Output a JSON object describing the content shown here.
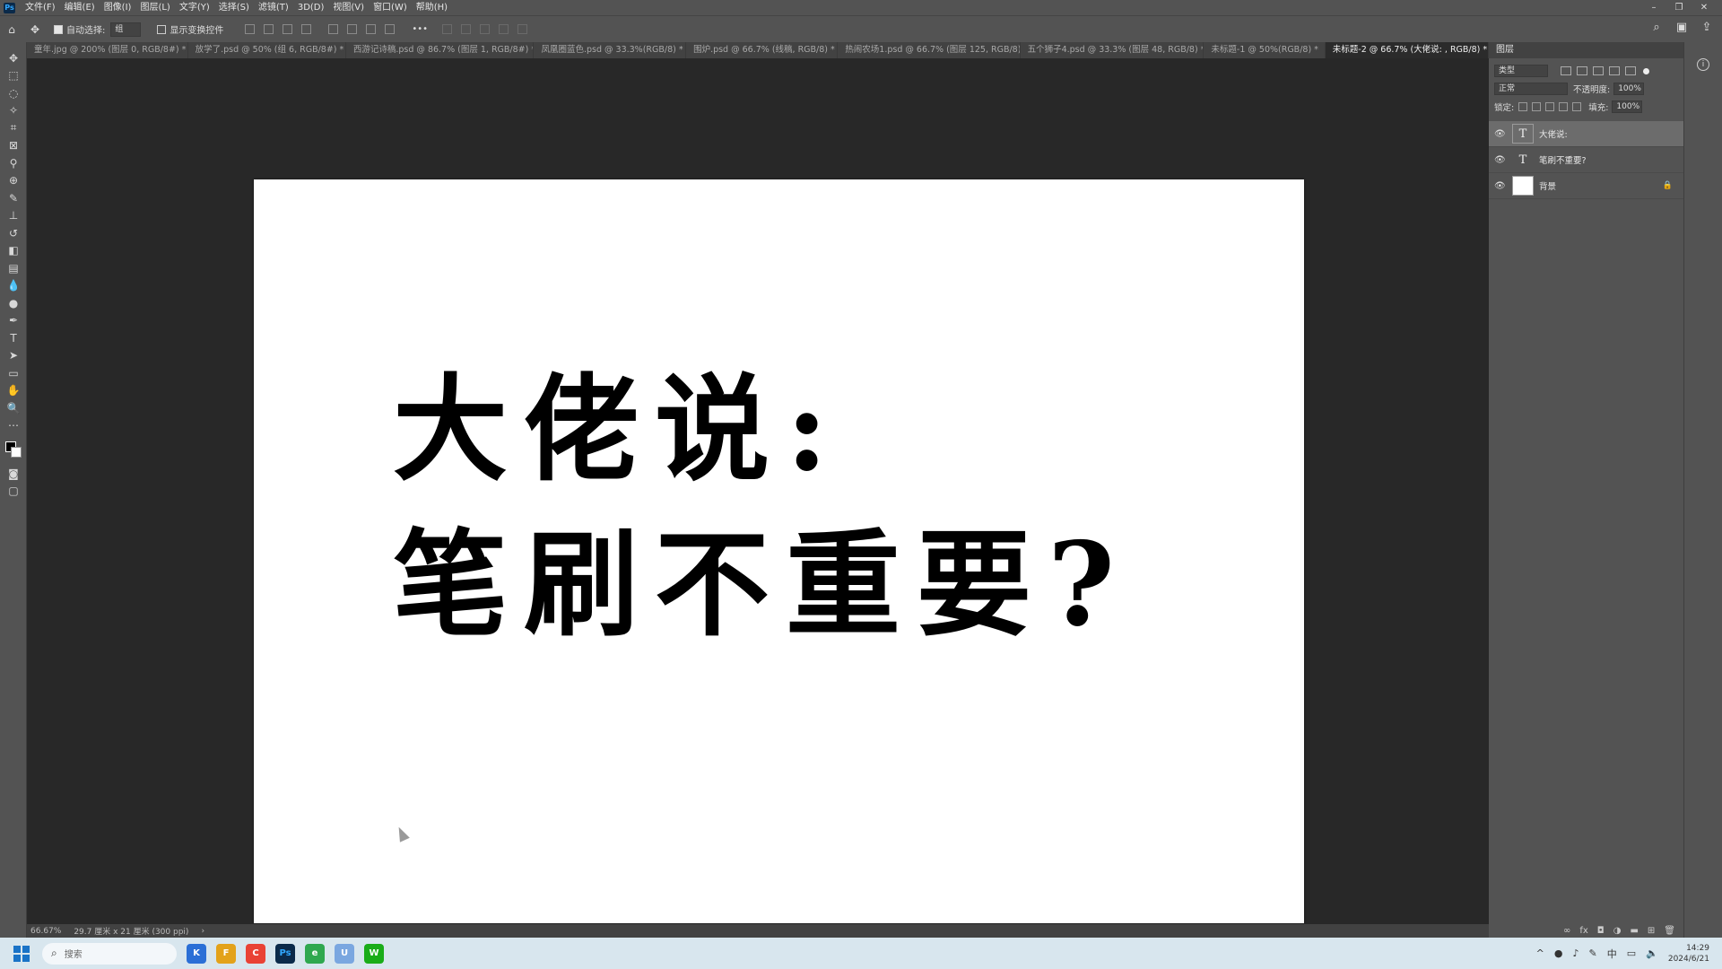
{
  "app": {
    "logo": "Ps"
  },
  "menu": [
    "文件(F)",
    "编辑(E)",
    "图像(I)",
    "图层(L)",
    "文字(Y)",
    "选择(S)",
    "滤镜(T)",
    "3D(D)",
    "视图(V)",
    "窗口(W)",
    "帮助(H)"
  ],
  "options_bar": {
    "auto_select_label": "自动选择:",
    "auto_select_value": "组",
    "show_transform_label": "显示变换控件",
    "more": "•••"
  },
  "tabs": [
    {
      "label": "童年.jpg @ 200% (图层 0, RGB/8#) *"
    },
    {
      "label": "放学了.psd @ 50% (组 6, RGB/8#) *"
    },
    {
      "label": "西游记诗稿.psd @ 86.7% (图层 1, RGB/8#) *"
    },
    {
      "label": "凤凰圈蓝色.psd @ 33.3%(RGB/8) *"
    },
    {
      "label": "围炉.psd @ 66.7% (线稿, RGB/8) *"
    },
    {
      "label": "热闹农场1.psd @ 66.7% (图层 125, RGB/8)"
    },
    {
      "label": "五个狮子4.psd @ 33.3% (图层 48, RGB/8) *"
    },
    {
      "label": "未标题-1 @ 50%(RGB/8) *"
    },
    {
      "label": "未标题-2 @ 66.7% (大佬说: , RGB/8) *"
    }
  ],
  "canvas": {
    "line1": "大佬说:",
    "line2": "笔刷不重要?"
  },
  "status": {
    "zoom": "66.67%",
    "doc_size": "29.7 厘米 x 21 厘米 (300 ppi)"
  },
  "layers_panel": {
    "title": "图层",
    "filter_kind": "类型",
    "blend_mode": "正常",
    "opacity_label": "不透明度:",
    "opacity_value": "100%",
    "lock_label": "锁定:",
    "fill_label": "填充:",
    "fill_value": "100%",
    "layers": [
      {
        "name": "大佬说:",
        "type": "text",
        "selected": true
      },
      {
        "name": "笔刷不重要?",
        "type": "text",
        "selected": false
      },
      {
        "name": "背景",
        "type": "background",
        "selected": false,
        "locked": true
      }
    ]
  },
  "taskbar": {
    "search_placeholder": "搜索",
    "apps": [
      "K",
      "F",
      "C",
      "Ps",
      "e",
      "U",
      "W"
    ],
    "ime": "中",
    "time": "14:29",
    "date": "2024/6/21"
  }
}
